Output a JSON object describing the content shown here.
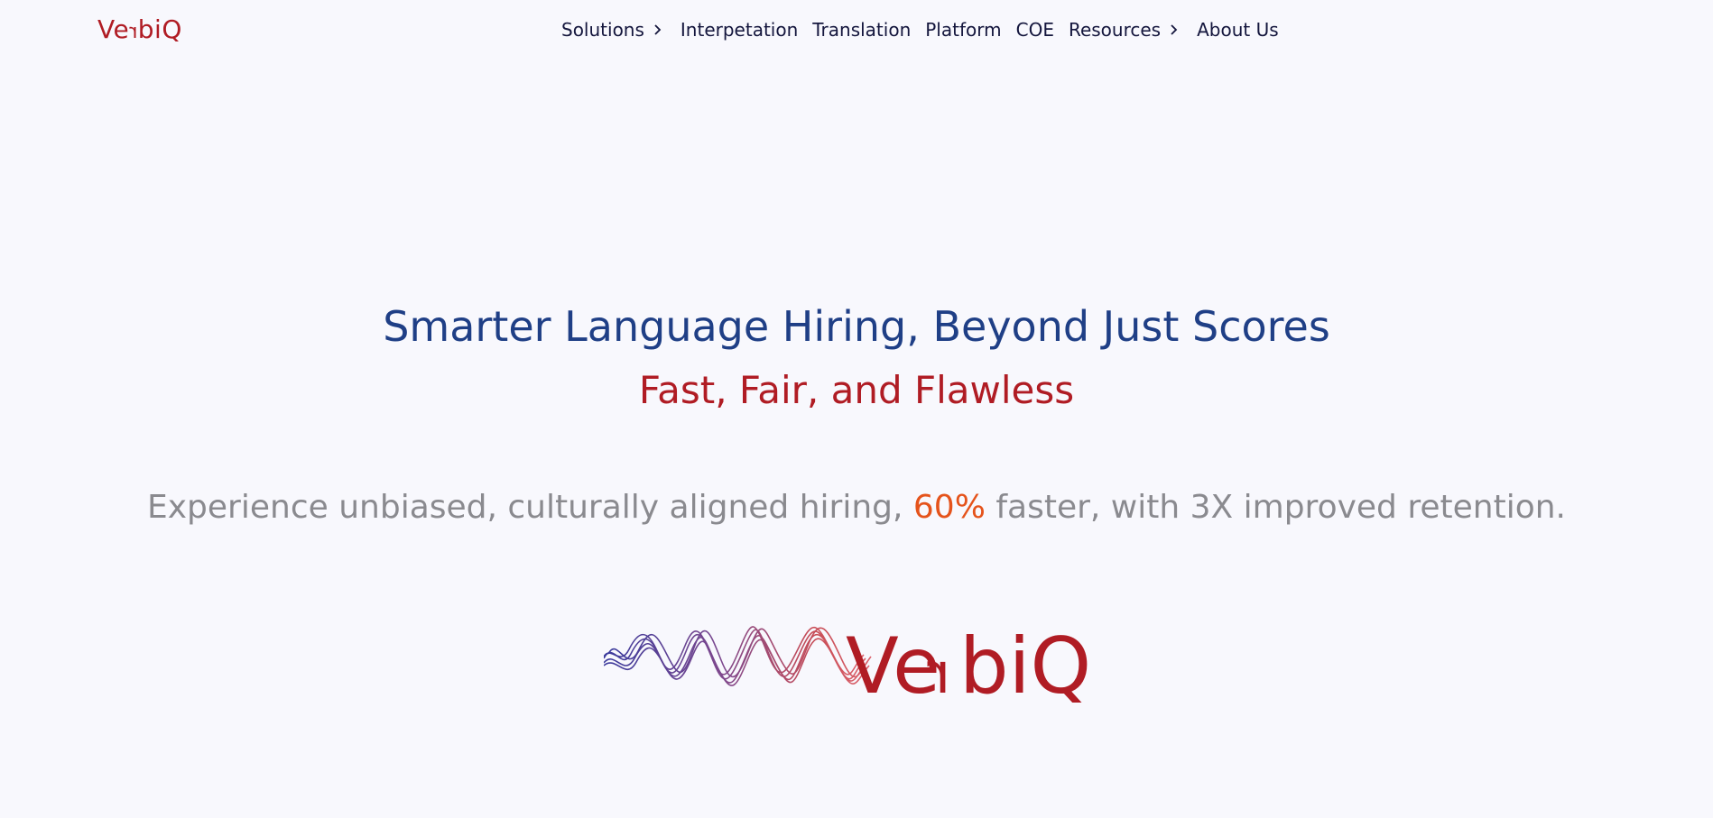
{
  "header": {
    "logo_text": {
      "part1": "Ve",
      "flipped": "r",
      "part2": "biQ"
    },
    "nav": [
      {
        "label": "Solutions",
        "has_chevron": true,
        "icon": "chevron-right-icon"
      },
      {
        "label": "Interpetation",
        "has_chevron": false
      },
      {
        "label": "Translation",
        "has_chevron": false
      },
      {
        "label": "Platform",
        "has_chevron": false
      },
      {
        "label": "COE",
        "has_chevron": false
      },
      {
        "label": "Resources",
        "has_chevron": true,
        "icon": "chevron-right-icon"
      },
      {
        "label": "About Us",
        "has_chevron": false
      }
    ]
  },
  "hero": {
    "title": "Smarter Language Hiring, Beyond Just Scores",
    "subtitle": "Fast, Fair, and Flawless",
    "tagline_before": "Experience unbiased, culturally aligned hiring, ",
    "tagline_highlight": "60%",
    "tagline_after": " faster, with 3X improved retention."
  },
  "brand_logo": {
    "part1": "Ve",
    "flipped": "r",
    "part2": "biQ",
    "icon": "waveform-logo"
  },
  "colors": {
    "background": "#f8f8fd",
    "brand_red": "#b01c24",
    "brand_blue": "#1f3f86",
    "nav_text": "#14163d",
    "tagline_gray": "#8a8a8f",
    "accent_orange": "#e5531b"
  }
}
